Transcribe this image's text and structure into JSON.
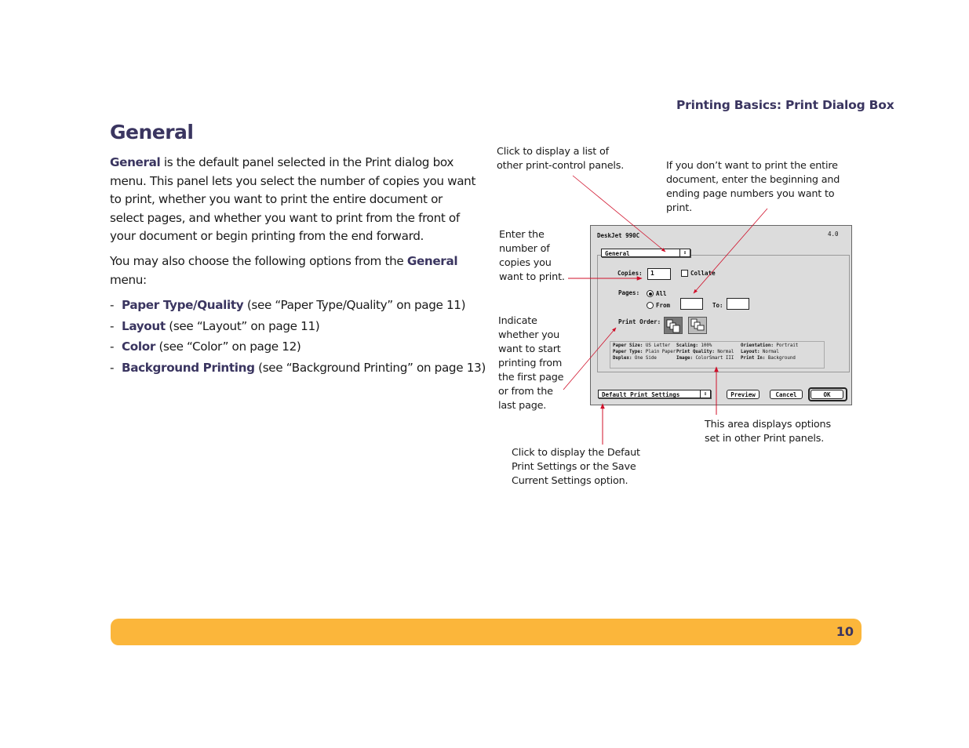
{
  "header": {
    "section": "Printing Basics: Print Dialog Box"
  },
  "page": {
    "title": "General",
    "intro": {
      "term": "General",
      "text": " is the default panel selected in the Print dialog box menu. This panel lets you select the number of copies you want to print, whether you want to print the entire document or select pages, and whether you want to print from the front of your document or begin printing from the end forward."
    },
    "options_intro": {
      "before": "You may also choose the following options from the ",
      "term": "General",
      "after": " menu:"
    },
    "options": [
      {
        "bullet": "-",
        "term": "Paper Type/Quality",
        "ref": " (see “Paper Type/Quality” on page 11)"
      },
      {
        "bullet": "-",
        "term": "Layout",
        "ref": " (see “Layout” on page 11)"
      },
      {
        "bullet": "-",
        "term": "Color",
        "ref": " (see “Color” on page 12)"
      },
      {
        "bullet": "-",
        "term": "Background Printing",
        "ref": " (see “Background Printing” on page 13)"
      }
    ]
  },
  "annotations": {
    "panels": "Click to display a list of other print-control panels.",
    "pages": "If you don’t want to print the entire document, enter the beginning and ending page numbers you want to print.",
    "copies": "Enter the number of copies you want to print.",
    "order": "Indicate whether you want to start printing from the first page or from the last page.",
    "summary": "This area displays options set in other Print panels.",
    "settings": "Click to display the Defaut Print Settings or the Save Current Settings option."
  },
  "dialog": {
    "printer": "DeskJet 990C",
    "version": "4.0",
    "panel_popup": "General",
    "copies_label": "Copies:",
    "copies_value": "1",
    "collate_label": "Collate",
    "collate_checked": false,
    "pages_label": "Pages:",
    "pages_all": "All",
    "pages_from": "From",
    "pages_to": "To:",
    "from_value": "",
    "to_value": "",
    "print_order_label": "Print Order:",
    "summary": {
      "col1": [
        {
          "k": "Paper Size:",
          "v": " US Letter"
        },
        {
          "k": "Paper Type:",
          "v": " Plain Paper"
        },
        {
          "k": "Duplex:",
          "v": " One Side"
        }
      ],
      "col2": [
        {
          "k": "Scaling:",
          "v": " 100%"
        },
        {
          "k": "Print Quality:",
          "v": " Normal"
        },
        {
          "k": "Image:",
          "v": " ColorSmart III"
        }
      ],
      "col3": [
        {
          "k": "Orientation:",
          "v": " Portrait"
        },
        {
          "k": "Layout:",
          "v": " Normal"
        },
        {
          "k": "Print In:",
          "v": " Background"
        }
      ]
    },
    "settings_popup": "Default Print Settings",
    "preview": "Preview",
    "cancel": "Cancel",
    "ok": "OK"
  },
  "footer": {
    "page_number": "10",
    "bar_color": "#fbb63b"
  },
  "colors": {
    "accent": "#3a3560",
    "callout_line": "#d0102a"
  }
}
